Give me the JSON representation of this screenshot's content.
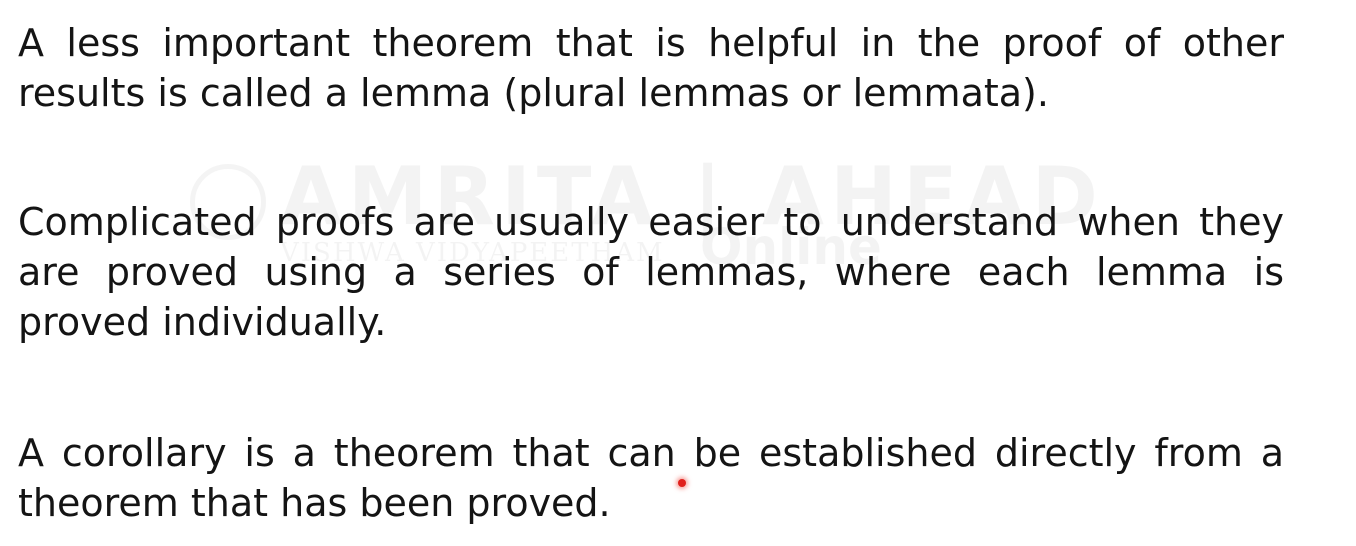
{
  "paragraphs": [
    "A less important theorem that is helpful in the proof of other results is called a lemma (plural lemmas or lemmata).",
    "Complicated proofs are usually easier to understand when they are proved using a series of lemmas, where each lemma is proved individually.",
    "A corollary is a theorem that can be established directly from a theorem that has been proved."
  ],
  "watermark": {
    "brand": "AMRITA | AHEAD",
    "subtitle": "VISHWA VIDYAPEETHAM",
    "online": "Online"
  },
  "colors": {
    "text": "#141414",
    "background": "#ffffff",
    "pointer": "#e0201c"
  }
}
